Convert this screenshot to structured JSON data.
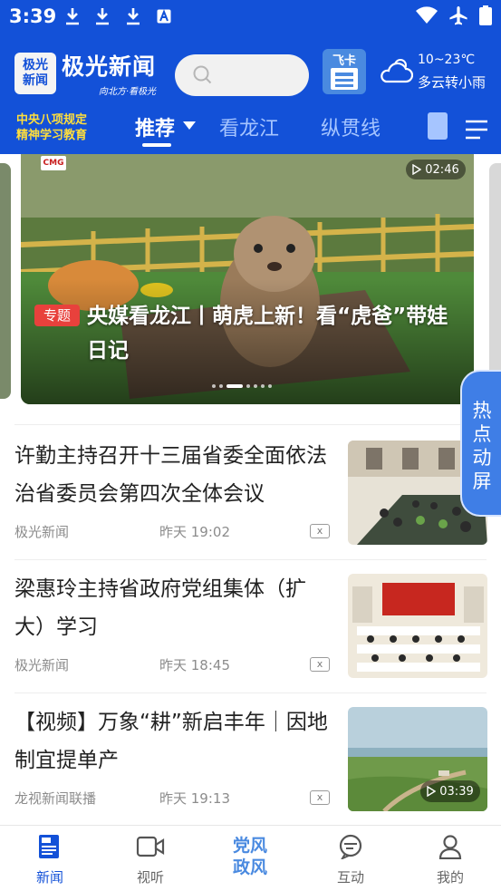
{
  "status": {
    "time": "3:39"
  },
  "brand": {
    "logo_line1": "极光",
    "logo_line2": "新闻",
    "name": "极光新闻",
    "slogan": "向北方·看极光"
  },
  "search": {
    "placeholder": ""
  },
  "feika": {
    "label": "飞卡"
  },
  "weather": {
    "temp": "10~23℃",
    "desc": "多云转小雨"
  },
  "nav_tabs": {
    "promo_line1": "中央八项规定",
    "promo_line2": "精神学习教育",
    "tabs": [
      {
        "label": "推荐",
        "active": true
      },
      {
        "label": "看龙江",
        "active": false
      },
      {
        "label": "纵贯线",
        "active": false
      }
    ]
  },
  "banner": {
    "duration": "02:46",
    "cmg_text": "CMG",
    "tag": "专题",
    "title": "央媒看龙江丨萌虎上新！看“虎爸”带娃日记",
    "slide_count": 7,
    "active_slide": 2
  },
  "hotspot": {
    "label": "热点动屏"
  },
  "news": [
    {
      "title": "许勤主持召开十三届省委全面依法治省委员会第四次全体会议",
      "source": "极光新闻",
      "time": "昨天 19:02",
      "dismiss": "x",
      "duration": ""
    },
    {
      "title": "梁惠玲主持省政府党组集体（扩大）学习",
      "source": "极光新闻",
      "time": "昨天 18:45",
      "dismiss": "x",
      "duration": ""
    },
    {
      "title": "【视频】万象“耕”新启丰年｜因地制宜提单产",
      "source": "龙视新闻联播",
      "time": "昨天 19:13",
      "dismiss": "x",
      "duration": "03:39"
    }
  ],
  "bottom_nav": {
    "items": [
      {
        "label": "新闻",
        "icon": "newspaper-icon",
        "active": true
      },
      {
        "label": "视听",
        "icon": "video-camera-icon",
        "active": false
      },
      {
        "label": "党风政风",
        "icon": "dangfeng-logo",
        "active": false
      },
      {
        "label": "互动",
        "icon": "chat-icon",
        "active": false
      },
      {
        "label": "我的",
        "icon": "person-icon",
        "active": false
      }
    ],
    "center_line1": "党风",
    "center_line2": "政风"
  },
  "colors": {
    "brand_blue": "#1351d8",
    "tab_inactive": "#a6c5ff",
    "promo_yellow": "#ffde3c",
    "tag_red": "#e8413c"
  }
}
